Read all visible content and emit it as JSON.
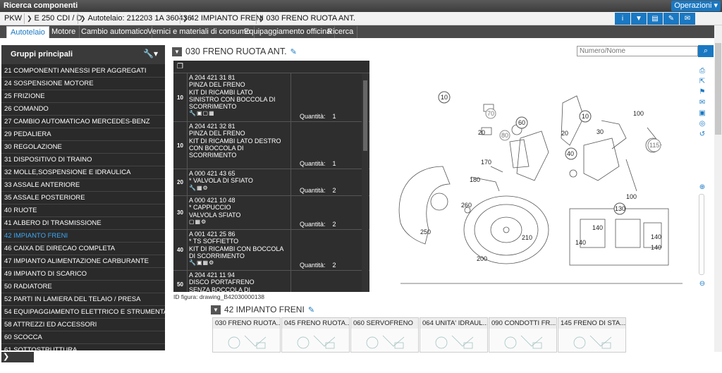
{
  "app": {
    "title": "Ricerca componenti",
    "operations_label": "Operazioni"
  },
  "breadcrumb": [
    "PKW",
    "E 250 CDI / D",
    "Autotelaio: 212203 1A 360436",
    "42 IMPIANTO FRENI",
    "030 FRENO RUOTA ANT."
  ],
  "toolbar_icons": [
    "info-icon",
    "filter-icon",
    "document-icon",
    "edit-icon",
    "mail-icon"
  ],
  "tabs": [
    "Autotelaio",
    "Motore",
    "Cambio automatico",
    "Vernici e materiali di consumo",
    "Equipaggiamento officina",
    "Ricerca"
  ],
  "active_tab": "Autotelaio",
  "sidebar": {
    "title": "Gruppi principali",
    "items": [
      "21 COMPONENTI ANNESSI PER AGGREGATI",
      "24 SOSPENSIONE MOTORE",
      "25 FRIZIONE",
      "26 COMANDO",
      "27 CAMBIO AUTOMATICAO MERCEDES-BENZ",
      "29 PEDALIERA",
      "30 REGOLAZIONE",
      "31 DISPOSITIVO DI TRAINO",
      "32 MOLLE,SOSPENSIONE E IDRAULICA",
      "33 ASSALE ANTERIORE",
      "35 ASSALE POSTERIORE",
      "40 RUOTE",
      "41 ALBERO DI TRASMISSIONE",
      "42 IMPIANTO FRENI",
      "46 CAIXA DE DIRECAO COMPLETA",
      "47 IMPIANTO ALIMENTAZIONE CARBURANTE",
      "49 IMPIANTO DI SCARICO",
      "50 RADIATORE",
      "52 PARTI IN LAMIERA DEL TELAIO / PRESA",
      "54 EQUIPAGGIAMENTO ELETTRICO E STRUMENTAZIONE",
      "58 ATTREZZI ED ACCESSORI",
      "60 SCOCCA",
      "61 SOTTOSTRUTTURA"
    ],
    "active_index": 13,
    "back_label": "Indietro"
  },
  "section": {
    "title": "030 FRENO RUOTA ANT.",
    "search_placeholder": "Numero/Nome"
  },
  "parts": [
    {
      "pos": "10",
      "lines": [
        "A 204 421 31 81",
        "PINZA DEL FRENO",
        "KIT DI RICAMBI LATO",
        "SINISTRO CON BOCCOLA DI",
        "SCORRIMENTO"
      ],
      "icons": "🔧▣▢▦",
      "qty_label": "Quantità:",
      "qty": "1"
    },
    {
      "pos": "10",
      "lines": [
        "A 204 421 32 81",
        "PINZA DEL FRENO",
        "KIT DI RICAMBI LATO DESTRO",
        "CON BOCCOLA DI",
        "SCORRIMENTO"
      ],
      "icons": "",
      "qty_label": "Quantità:",
      "qty": "1"
    },
    {
      "pos": "20",
      "lines": [
        "A 000 421 43 65",
        "* VALVOLA DI SFIATO"
      ],
      "icons": "🔧▦⚙",
      "qty_label": "Quantità:",
      "qty": "2"
    },
    {
      "pos": "30",
      "lines": [
        "A 000 421 10 48",
        "* CAPPUCCIO",
        "VALVOLA SFIATO"
      ],
      "icons": "▢▦⚙",
      "qty_label": "Quantità:",
      "qty": "2"
    },
    {
      "pos": "40",
      "lines": [
        "A 001 421 25 86",
        "* TS SOFFIETTO",
        "KIT DI RICAMBI CON BOCCOLA",
        "DI SCORRIMENTO"
      ],
      "icons": "🔧▣▦⚙",
      "qty_label": "Quantità:",
      "qty": "2"
    },
    {
      "pos": "50",
      "lines": [
        "A 204 421 11 94",
        "DISCO PORTAFRENO",
        "SENZA BOCCOLA DI"
      ],
      "icons": "",
      "qty_label": "",
      "qty": ""
    }
  ],
  "figure_id": "ID figura: drawing_B42030000138",
  "drawing_labels": [
    "10",
    "70",
    "80",
    "60",
    "20",
    "170",
    "180",
    "260",
    "250",
    "200",
    "210",
    "10",
    "20",
    "30",
    "40",
    "100",
    "115",
    "100",
    "130",
    "140",
    "140",
    "140",
    "140"
  ],
  "right_tools": [
    "print-icon",
    "export-icon",
    "flag-icon",
    "comment-icon",
    "save-icon",
    "target-icon",
    "reset-icon",
    "zoom-in-icon",
    "zoom-out-icon"
  ],
  "group": {
    "title": "42 IMPIANTO FRENI",
    "thumbs": [
      "030 FRENO RUOTA...",
      "045 FRENO RUOTA...",
      "060 SERVOFRENO",
      "064 UNITA' IDRAUL...",
      "090 CONDOTTI FR...",
      "145 FRENO DI STA..."
    ]
  },
  "colors": {
    "accent": "#1a78c2",
    "sidebar_bg": "#2a2a2a",
    "active_item": "#3ea9f5"
  }
}
